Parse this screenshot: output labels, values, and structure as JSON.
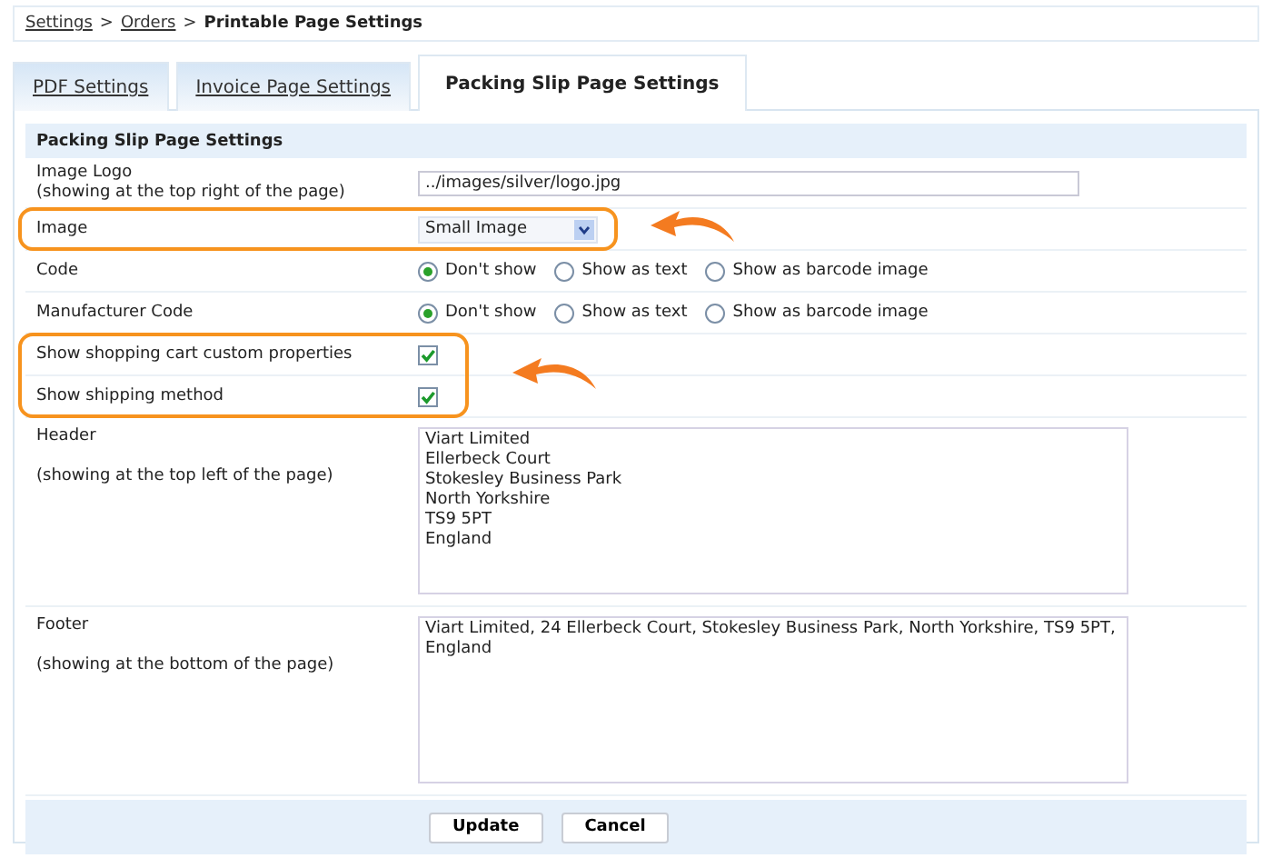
{
  "breadcrumb": [
    {
      "label": "Settings",
      "kind": "link"
    },
    {
      "label": ">",
      "kind": "separator"
    },
    {
      "label": "Orders",
      "kind": "link"
    },
    {
      "label": ">",
      "kind": "separator"
    },
    {
      "label": "Printable Page Settings",
      "kind": "current"
    }
  ],
  "tabs": [
    {
      "label": "PDF Settings",
      "selected": false
    },
    {
      "label": "Invoice Page Settings",
      "selected": false
    },
    {
      "label": "Packing Slip Page Settings",
      "selected": true
    }
  ],
  "section_title": "Packing Slip Page Settings",
  "fields": [
    {
      "kind": "text",
      "label": "Image Logo",
      "note": "(showing at the top right of the page)",
      "value": "../images/silver/logo.jpg",
      "highlighted": false
    },
    {
      "kind": "select",
      "label": "Image",
      "value": "Small Image",
      "highlighted": true
    },
    {
      "kind": "radio",
      "label": "Code",
      "highlighted": false,
      "options": [
        {
          "label": "Don't show",
          "selected": true
        },
        {
          "label": "Show as text",
          "selected": false
        },
        {
          "label": "Show as barcode image",
          "selected": false
        }
      ]
    },
    {
      "kind": "radio",
      "label": "Manufacturer Code",
      "highlighted": false,
      "options": [
        {
          "label": "Don't show",
          "selected": true
        },
        {
          "label": "Show as text",
          "selected": false
        },
        {
          "label": "Show as barcode image",
          "selected": false
        }
      ]
    },
    {
      "kind": "checkbox",
      "label": "Show shopping cart custom properties",
      "checked": true,
      "highlighted": true
    },
    {
      "kind": "checkbox",
      "label": "Show shipping method",
      "checked": true,
      "highlighted": true
    },
    {
      "kind": "textarea",
      "label": "Header",
      "note": "(showing at the top left of the page)",
      "value": "Viart Limited\nEllerbeck Court\nStokesley Business Park\nNorth Yorkshire\nTS9 5PT\nEngland",
      "highlighted": false
    },
    {
      "kind": "textarea",
      "label": "Footer",
      "note": "(showing at the bottom of the page)",
      "value": "Viart Limited, 24 Ellerbeck Court, Stokesley Business Park, North Yorkshire, TS9 5PT, England",
      "highlighted": false
    }
  ],
  "buttons": [
    "Update",
    "Cancel"
  ]
}
